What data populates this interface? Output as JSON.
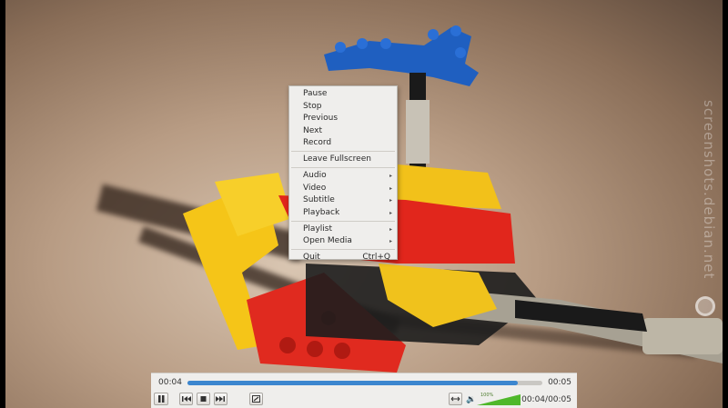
{
  "watermark": "screenshots.debian.net",
  "menu": {
    "items": [
      {
        "label": "Pause"
      },
      {
        "label": "Stop"
      },
      {
        "label": "Previous"
      },
      {
        "label": "Next"
      },
      {
        "label": "Record"
      },
      {
        "label": "Leave Fullscreen"
      },
      {
        "label": "Audio",
        "submenu": true
      },
      {
        "label": "Video",
        "submenu": true
      },
      {
        "label": "Subtitle",
        "submenu": true
      },
      {
        "label": "Playback",
        "submenu": true
      },
      {
        "label": "Playlist",
        "submenu": true
      },
      {
        "label": "Open Media",
        "submenu": true
      },
      {
        "label": "Quit",
        "shortcut": "Ctrl+Q"
      }
    ]
  },
  "controller": {
    "elapsed": "00:04",
    "remaining": "00:05",
    "progress_fraction": 0.93,
    "time_display": "00:04/00:05",
    "volume_label": "100%",
    "volume_fraction": 1.0,
    "accent_color": "#3c86cf",
    "volume_color": "#4fb82a",
    "icons": {
      "play_pause": "pause-icon",
      "previous": "skip-previous-icon",
      "stop": "stop-icon",
      "next": "skip-next-icon",
      "fullscreen": "fullscreen-icon",
      "loop": "loop-icon",
      "volume": "speaker-icon"
    }
  }
}
